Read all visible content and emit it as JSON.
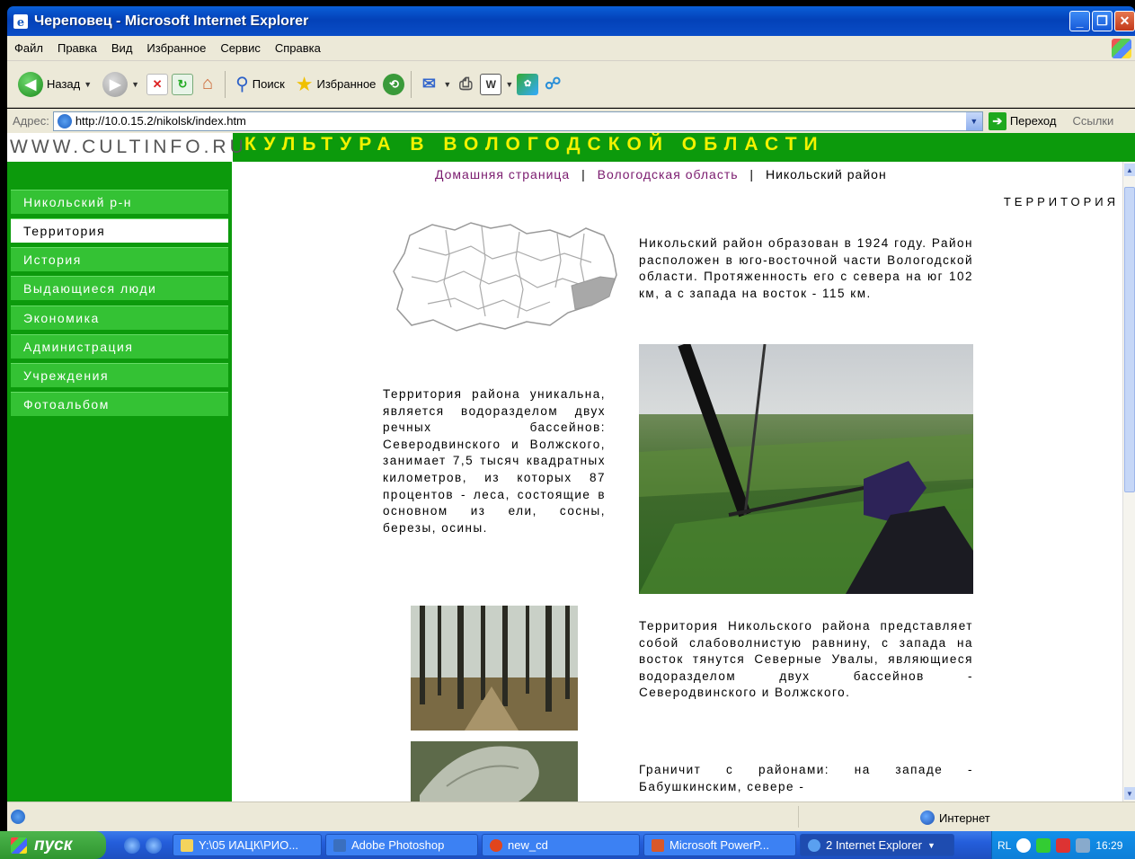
{
  "window": {
    "title": "Череповец - Microsoft Internet Explorer",
    "buttons": [
      "_",
      "❐",
      "✕"
    ]
  },
  "menu": [
    "Файл",
    "Правка",
    "Вид",
    "Избранное",
    "Сервис",
    "Справка"
  ],
  "toolbar": {
    "back_label": "Назад",
    "search_label": "Поиск",
    "favorites_label": "Избранное"
  },
  "address": {
    "label": "Адрес:",
    "url": "http://10.0.15.2/nikolsk/index.htm",
    "go_label": "Переход",
    "links_label": "Ссылки"
  },
  "site": {
    "url_text": "WWW.CULTINFO.RU",
    "title": "КУЛЬТУРА В ВОЛОГОДСКОЙ ОБЛАСТИ",
    "colors": {
      "header_green": "#0c9a0c",
      "title_yellow": "#f2f200",
      "link_purple": "#7a1a6e"
    }
  },
  "nav": [
    "Никольский р-н",
    "Территория",
    "История",
    "Выдающиеся люди",
    "Экономика",
    "Администрация",
    "Учреждения",
    "Фотоальбом"
  ],
  "nav_active_index": 1,
  "breadcrumb": {
    "home": "Домашняя страница",
    "region": "Вологодская область",
    "separator": "|",
    "current": "Никольский район"
  },
  "section_title": "ТЕРРИТОРИЯ",
  "content": {
    "intro": "Никольский район образован в 1924 году. Район расположен в юго-восточной части Вологодской области. Протяженность его с севера на юг 102 км, а с запада на восток - 115 км.",
    "territory": "Территория района уникальна, является водоразделом двух речных бассейнов: Северодвинского и Волжского, занимает 7,5 тысяч квадратных километров, из которых 87 процентов - леса, состоящие в основном из ели, сосны, березы, осины.",
    "relief": "Территория Никольского района представляет собой слабоволнистую равнину, с запада на восток тянутся Северные Увалы, являющиеся водоразделом двух бассейнов - Северодвинского и Волжского.",
    "borders": "Граничит с районами: на западе - Бабушкинским, севере -"
  },
  "statusbar": {
    "zone": "Интернет"
  },
  "taskbar": {
    "start_label": "пуск",
    "tasks": [
      "Y:\\05 ИАЦК\\РИО...",
      "Adobe Photoshop",
      "new_cd",
      "Microsoft PowerP...",
      "2 Internet Explorer"
    ],
    "lang": "RL",
    "clock": "16:29"
  }
}
